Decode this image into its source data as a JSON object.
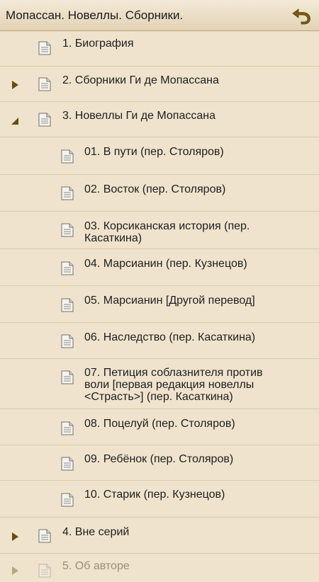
{
  "header": {
    "title": "Мопассан. Новеллы. Сборники.",
    "back_icon": "undo-arrow-icon",
    "accent": "#7a5a12"
  },
  "items": [
    {
      "label": "1. Биография",
      "level": 0,
      "expander": "none"
    },
    {
      "label": "2. Сборники Ги де Мопассана",
      "level": 0,
      "expander": "collapsed"
    },
    {
      "label": "3. Новеллы Ги де Мопассана",
      "level": 0,
      "expander": "expanded"
    },
    {
      "label": "01. В пути (пер. Столяров)",
      "level": 1,
      "expander": "none"
    },
    {
      "label": "02. Восток (пер. Столяров)",
      "level": 1,
      "expander": "none"
    },
    {
      "label": "03. Корсиканская история (пер. Касаткина)",
      "level": 1,
      "expander": "none"
    },
    {
      "label": "04. Марсианин (пер. Кузнецов)",
      "level": 1,
      "expander": "none"
    },
    {
      "label": "05. Марсианин [Другой перевод]",
      "level": 1,
      "expander": "none"
    },
    {
      "label": "06. Наследство (пер. Касаткина)",
      "level": 1,
      "expander": "none"
    },
    {
      "label": "07. Петиция соблазнителя против воли [первая редакция новеллы <Страсть>] (пер. Касаткина)",
      "level": 1,
      "expander": "none"
    },
    {
      "label": "08. Поцелуй (пер. Столяров)",
      "level": 1,
      "expander": "none"
    },
    {
      "label": "09. Ребёнок (пер. Столяров)",
      "level": 1,
      "expander": "none"
    },
    {
      "label": "10. Старик (пер. Кузнецов)",
      "level": 1,
      "expander": "none"
    },
    {
      "label": "4. Вне серий",
      "level": 0,
      "expander": "collapsed"
    },
    {
      "label": "5. Об авторе",
      "level": 0,
      "expander": "collapsed"
    }
  ]
}
